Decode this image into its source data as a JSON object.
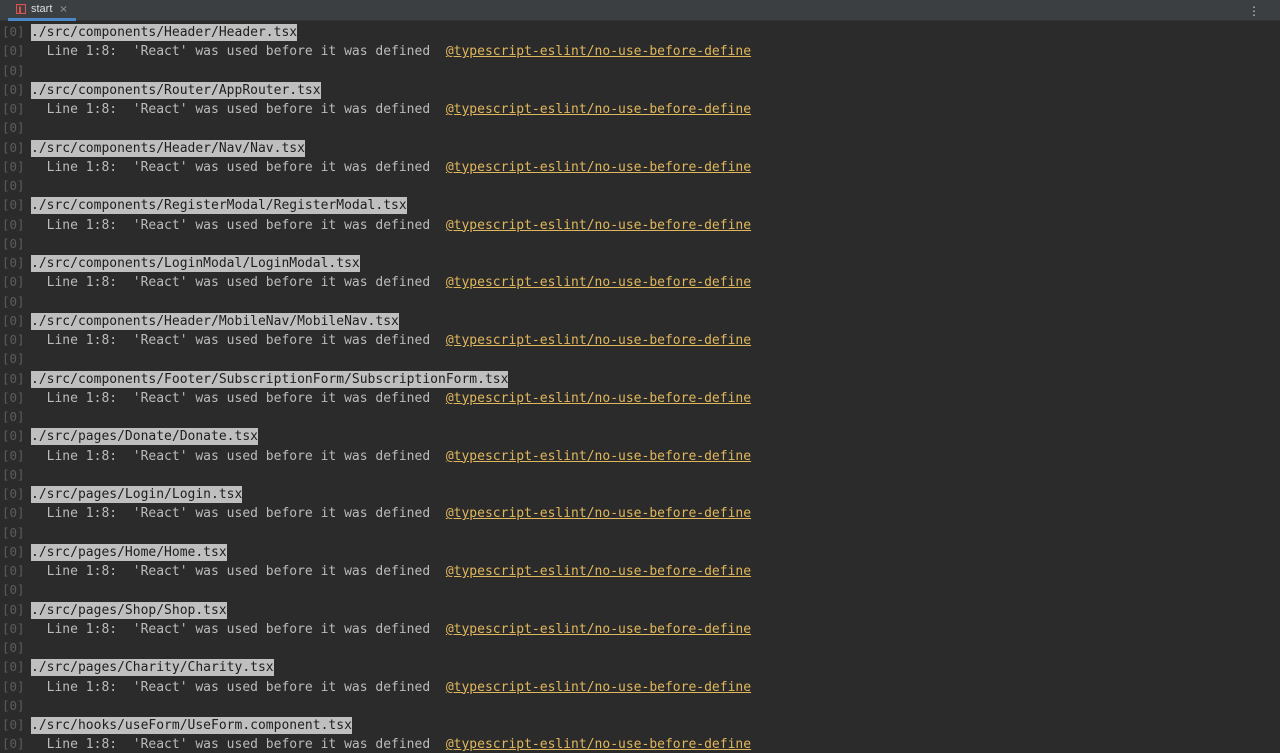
{
  "tab": {
    "label": "start",
    "icon": "npm-run-icon",
    "close_glyph": "×"
  },
  "menu": {
    "glyph": "⋮"
  },
  "prefix": "[0]",
  "warnings": [
    {
      "file": "./src/components/Header/Header.tsx",
      "message": "  Line 1:8:  'React' was used before it was defined  ",
      "rule": "@typescript-eslint/no-use-before-define"
    },
    {
      "file": "./src/components/Router/AppRouter.tsx",
      "message": "  Line 1:8:  'React' was used before it was defined  ",
      "rule": "@typescript-eslint/no-use-before-define"
    },
    {
      "file": "./src/components/Header/Nav/Nav.tsx",
      "message": "  Line 1:8:  'React' was used before it was defined  ",
      "rule": "@typescript-eslint/no-use-before-define"
    },
    {
      "file": "./src/components/RegisterModal/RegisterModal.tsx",
      "message": "  Line 1:8:  'React' was used before it was defined  ",
      "rule": "@typescript-eslint/no-use-before-define"
    },
    {
      "file": "./src/components/LoginModal/LoginModal.tsx",
      "message": "  Line 1:8:  'React' was used before it was defined  ",
      "rule": "@typescript-eslint/no-use-before-define"
    },
    {
      "file": "./src/components/Header/MobileNav/MobileNav.tsx",
      "message": "  Line 1:8:  'React' was used before it was defined  ",
      "rule": "@typescript-eslint/no-use-before-define"
    },
    {
      "file": "./src/components/Footer/SubscriptionForm/SubscriptionForm.tsx",
      "message": "  Line 1:8:  'React' was used before it was defined  ",
      "rule": "@typescript-eslint/no-use-before-define"
    },
    {
      "file": "./src/pages/Donate/Donate.tsx",
      "message": "  Line 1:8:  'React' was used before it was defined  ",
      "rule": "@typescript-eslint/no-use-before-define"
    },
    {
      "file": "./src/pages/Login/Login.tsx",
      "message": "  Line 1:8:  'React' was used before it was defined  ",
      "rule": "@typescript-eslint/no-use-before-define"
    },
    {
      "file": "./src/pages/Home/Home.tsx",
      "message": "  Line 1:8:  'React' was used before it was defined  ",
      "rule": "@typescript-eslint/no-use-before-define"
    },
    {
      "file": "./src/pages/Shop/Shop.tsx",
      "message": "  Line 1:8:  'React' was used before it was defined  ",
      "rule": "@typescript-eslint/no-use-before-define"
    },
    {
      "file": "./src/pages/Charity/Charity.tsx",
      "message": "  Line 1:8:  'React' was used before it was defined  ",
      "rule": "@typescript-eslint/no-use-before-define"
    },
    {
      "file": "./src/hooks/useForm/UseForm.component.tsx",
      "message": "  Line 1:8:  'React' was used before it was defined  ",
      "rule": "@typescript-eslint/no-use-before-define"
    }
  ],
  "colors": {
    "background": "#2b2b2b",
    "tabbar": "#3c3f41",
    "tab_underline": "#4a88c7",
    "path_highlight": "#bfbfbf",
    "rule_link": "#e0b75c",
    "prefix": "#5c5c5c"
  }
}
